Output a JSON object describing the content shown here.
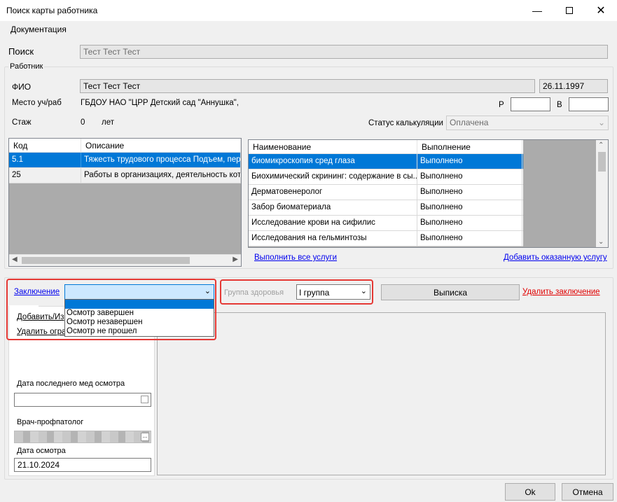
{
  "window": {
    "title": "Поиск карты работника"
  },
  "menu": {
    "items": [
      "Документация"
    ]
  },
  "search": {
    "label": "Поиск",
    "value": "Тест Тест Тест"
  },
  "worker": {
    "legend": "Работник",
    "fio_label": "ФИО",
    "fio_value": "Тест Тест Тест",
    "birth_date": "26.11.1997",
    "workplace_label": "Место уч/раб",
    "workplace_value": "ГБДОУ НАО \"ЦРР  Детский сад \"Аннушка\",",
    "r_label": "Р",
    "v_label": "В",
    "experience_label": "Стаж",
    "experience_value": "0",
    "experience_unit": "лет",
    "calc_status_label": "Статус калькуляции",
    "calc_status_value": "Оплачена"
  },
  "factors_table": {
    "columns": [
      "Код",
      "Описание"
    ],
    "rows": [
      {
        "code": "5.1",
        "desc": "Тяжесть трудового процесса Подъем, перем"
      },
      {
        "code": "25",
        "desc": "Работы в организациях, деятельность котор"
      }
    ]
  },
  "services_table": {
    "columns": [
      "Наименование",
      "Выполнение"
    ],
    "rows": [
      {
        "name": "биомикроскопия сред глаза",
        "status": "Выполнено"
      },
      {
        "name": "Биохимический скрининг: содержание в сы...",
        "status": "Выполнено"
      },
      {
        "name": "Дерматовенеролог",
        "status": "Выполнено"
      },
      {
        "name": "Забор биоматериала",
        "status": "Выполнено"
      },
      {
        "name": "Исследование крови на сифилис",
        "status": "Выполнено"
      },
      {
        "name": "Исследования на гельминтозы",
        "status": "Выполнено"
      }
    ]
  },
  "links": {
    "do_all": "Выполнить все услуги",
    "add_service": "Добавить оказанную услугу",
    "conclusion": "Заключение",
    "delete_conclusion": "Удалить заключение",
    "add_edit": "Добавить/Из",
    "delete_restriction": "Удалить огра"
  },
  "conclusion": {
    "selected": "",
    "options": [
      "",
      "Осмотр завершен",
      "Осмотр незавершен",
      "Осмотр не прошел"
    ]
  },
  "health_group": {
    "label": "Группа здоровья",
    "value": "I группа"
  },
  "buttons": {
    "extract": "Выписка",
    "ok": "Ok",
    "cancel": "Отмена"
  },
  "left_panel": {
    "last_exam_label": "Дата последнего мед осмотра",
    "doctor_label": "Врач-профпатолог",
    "exam_date_label": "Дата осмотра",
    "exam_date_value": "21.10.2024"
  },
  "colors": {
    "accent": "#0078d7",
    "highlight": "#e53935",
    "danger_link": "#e00000"
  }
}
